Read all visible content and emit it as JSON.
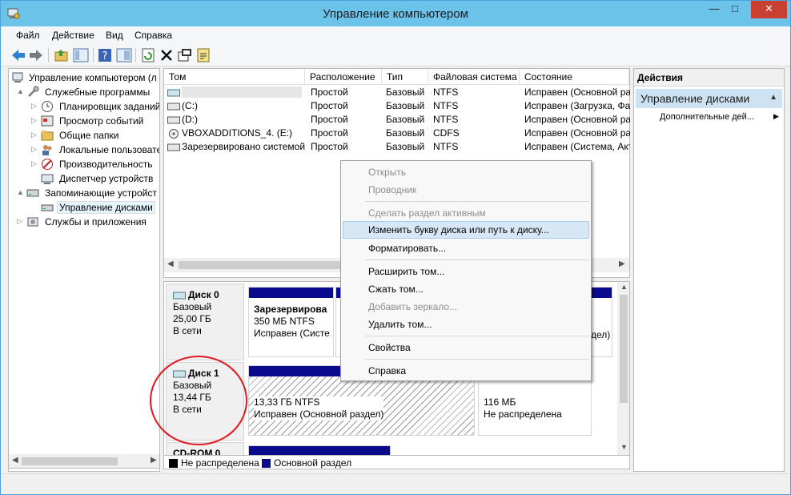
{
  "window": {
    "title": "Управление компьютером",
    "min": "—",
    "max": "□",
    "close": "✕"
  },
  "menu": [
    "Файл",
    "Действие",
    "Вид",
    "Справка"
  ],
  "toolbar": [
    "back-icon",
    "forward-icon",
    "up-folder-icon",
    "show-tree-icon",
    "help-icon",
    "properties-icon",
    "refresh-icon",
    "delete-icon",
    "checklist-icon",
    "export-icon"
  ],
  "tree": {
    "root": "Управление компьютером (л",
    "items": [
      {
        "label": "Служебные программы",
        "level": 1,
        "expander": "▲"
      },
      {
        "label": "Планировщик заданий",
        "level": 2,
        "expander": "▷"
      },
      {
        "label": "Просмотр событий",
        "level": 2,
        "expander": "▷"
      },
      {
        "label": "Общие папки",
        "level": 2,
        "expander": "▷"
      },
      {
        "label": "Локальные пользовате",
        "level": 2,
        "expander": "▷"
      },
      {
        "label": "Производительность",
        "level": 2,
        "expander": "▷"
      },
      {
        "label": "Диспетчер устройств",
        "level": 2,
        "expander": ""
      },
      {
        "label": "Запоминающие устройст",
        "level": 1,
        "expander": "▲"
      },
      {
        "label": "Управление дисками",
        "level": 2,
        "expander": ""
      },
      {
        "label": "Службы и приложения",
        "level": 1,
        "expander": "▷"
      }
    ]
  },
  "volumes": {
    "headers": [
      "Том",
      "Расположение",
      "Тип",
      "Файловая система",
      "Состояние"
    ],
    "rows": [
      {
        "name": "",
        "location": "Простой",
        "type": "Базовый",
        "fs": "NTFS",
        "status": "Исправен (Основной разд"
      },
      {
        "name": "(C:)",
        "location": "Простой",
        "type": "Базовый",
        "fs": "NTFS",
        "status": "Исправен (Загрузка, Фа"
      },
      {
        "name": "(D:)",
        "location": "Простой",
        "type": "Базовый",
        "fs": "NTFS",
        "status": "Исправен (Основной разд"
      },
      {
        "name": "VBOXADDITIONS_4. (E:)",
        "location": "Простой",
        "type": "Базовый",
        "fs": "CDFS",
        "status": "Исправен (Основной разд"
      },
      {
        "name": "Зарезервировано системой",
        "location": "Простой",
        "type": "Базовый",
        "fs": "NTFS",
        "status": "Исправен (Система, Акт"
      }
    ]
  },
  "disks": {
    "disk0": {
      "name": "Диск 0",
      "type": "Базовый",
      "size": "25,00 ГБ",
      "state": "В сети",
      "part1": {
        "name": "Зарезервирова",
        "size": "350 МБ NTFS",
        "status": "Исправен (Систе"
      },
      "part_right_fragment": "дел)"
    },
    "disk1": {
      "name": "Диск 1",
      "type": "Базовый",
      "size": "13,44 ГБ",
      "state": "В сети",
      "part1": {
        "size": "13,33 ГБ NTFS",
        "status": "Исправен (Основной раздел)"
      },
      "part2": {
        "size": "116 МБ",
        "status": "Не распределена"
      }
    },
    "cdrom": {
      "name": "CD-ROM 0"
    }
  },
  "legend": [
    {
      "label": "Не распределена",
      "color": "#000000"
    },
    {
      "label": "Основной раздел",
      "color": "#0a0a8c"
    }
  ],
  "actions": {
    "header": "Действия",
    "section": "Управление дисками",
    "item": "Дополнительные дей..."
  },
  "context_menu": [
    {
      "label": "Открыть",
      "disabled": true
    },
    {
      "label": "Проводник",
      "disabled": true
    },
    {
      "sep": true
    },
    {
      "label": "Сделать раздел активным",
      "disabled": true
    },
    {
      "label": "Изменить букву диска или путь к диску...",
      "disabled": false,
      "hover": true
    },
    {
      "label": "Форматировать...",
      "disabled": false
    },
    {
      "sep": true
    },
    {
      "label": "Расширить том...",
      "disabled": false
    },
    {
      "label": "Сжать том...",
      "disabled": false
    },
    {
      "label": "Добавить зеркало...",
      "disabled": true
    },
    {
      "label": "Удалить том...",
      "disabled": false
    },
    {
      "sep": true
    },
    {
      "label": "Свойства",
      "disabled": false
    },
    {
      "sep": true
    },
    {
      "label": "Справка",
      "disabled": false
    }
  ],
  "colors": {
    "titlebar": "#6cc3ea",
    "close": "#c84031",
    "primary_partition": "#0a0a8c",
    "annotation": "#e2161c",
    "highlight": "#d7e7f6"
  }
}
